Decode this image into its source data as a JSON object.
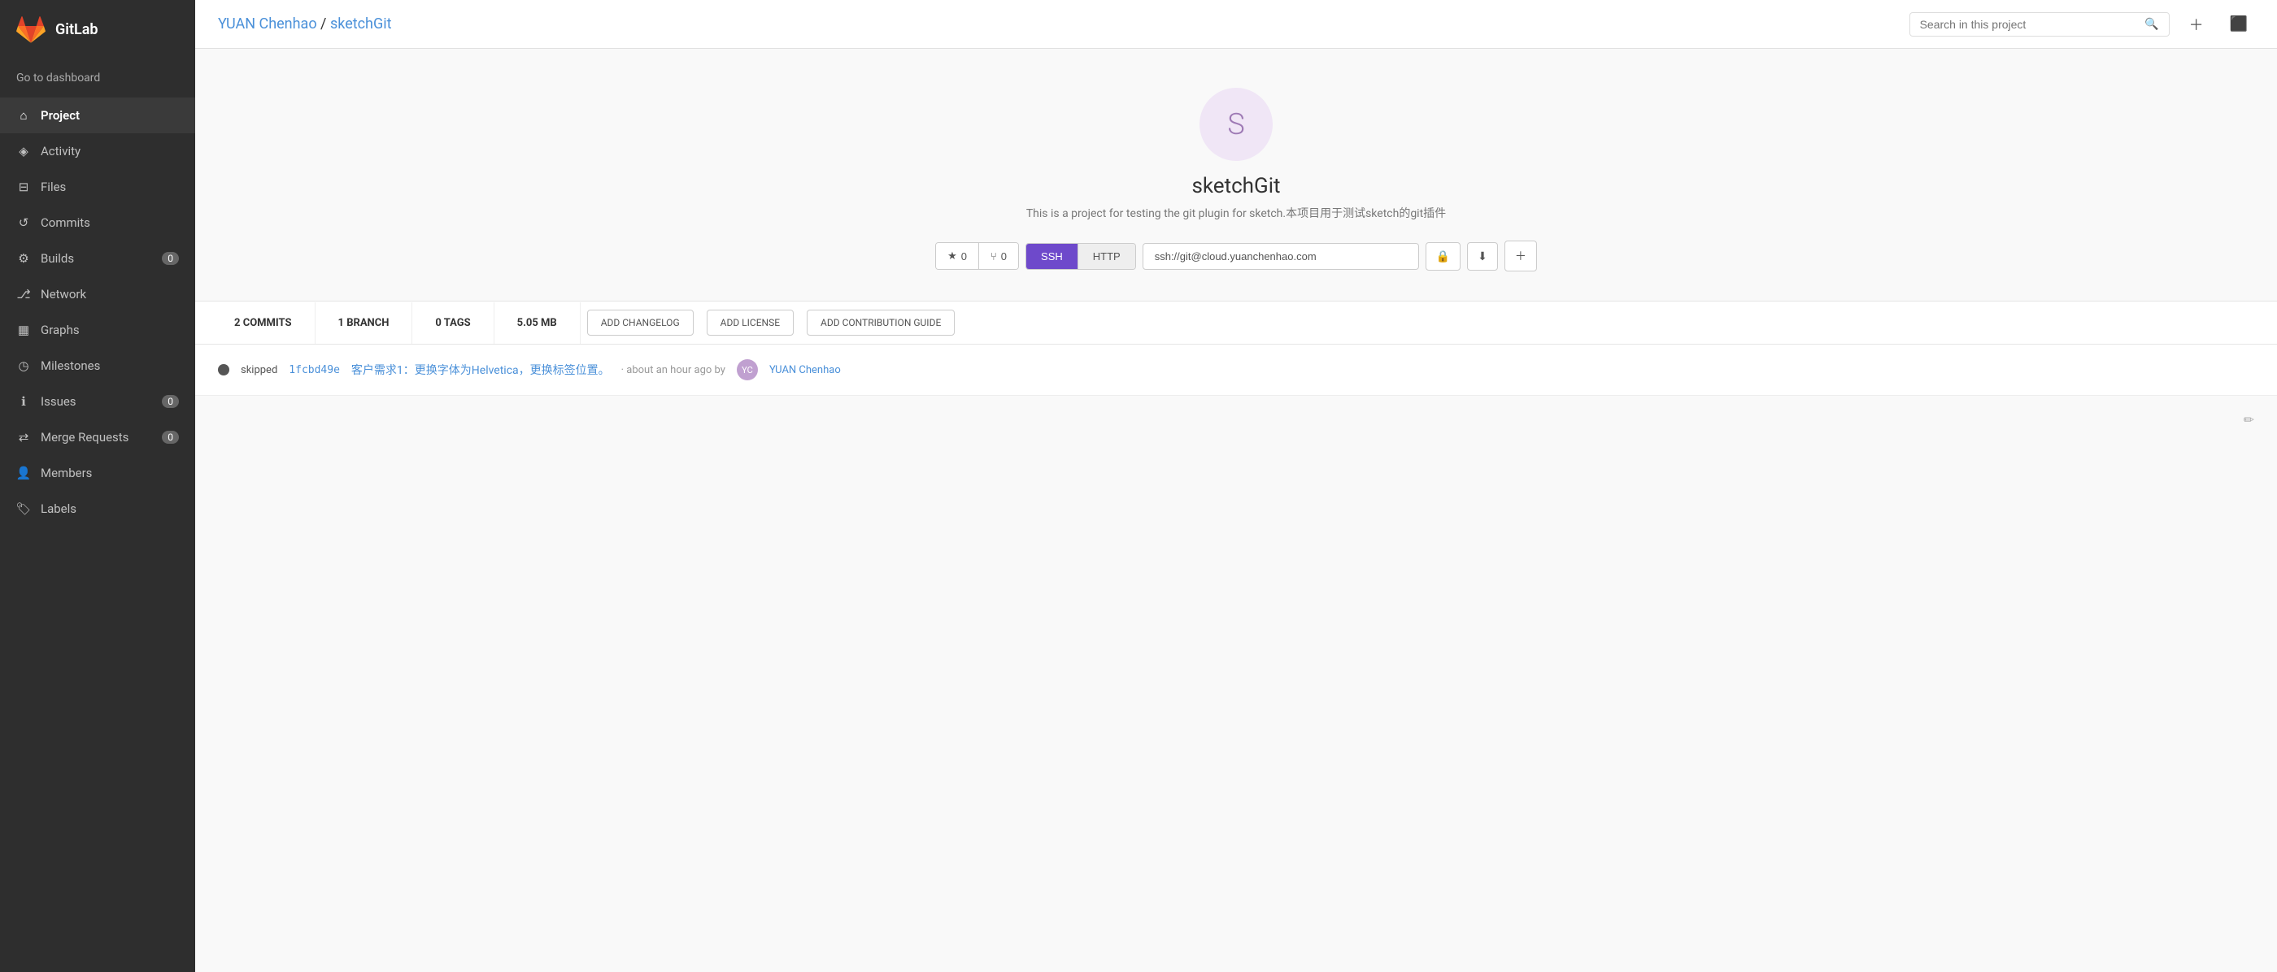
{
  "app": {
    "name": "GitLab"
  },
  "sidebar": {
    "dashboard_label": "Go to dashboard",
    "items": [
      {
        "id": "project",
        "label": "Project",
        "icon": "🏠",
        "active": true,
        "badge": null
      },
      {
        "id": "activity",
        "label": "Activity",
        "icon": "📊",
        "active": false,
        "badge": null
      },
      {
        "id": "files",
        "label": "Files",
        "icon": "📁",
        "active": false,
        "badge": null
      },
      {
        "id": "commits",
        "label": "Commits",
        "icon": "↩",
        "active": false,
        "badge": null
      },
      {
        "id": "builds",
        "label": "Builds",
        "icon": "🔧",
        "active": false,
        "badge": "0"
      },
      {
        "id": "network",
        "label": "Network",
        "icon": "🌿",
        "active": false,
        "badge": null
      },
      {
        "id": "graphs",
        "label": "Graphs",
        "icon": "📈",
        "active": false,
        "badge": null
      },
      {
        "id": "milestones",
        "label": "Milestones",
        "icon": "🕐",
        "active": false,
        "badge": null
      },
      {
        "id": "issues",
        "label": "Issues",
        "icon": "ℹ",
        "active": false,
        "badge": "0"
      },
      {
        "id": "merge-requests",
        "label": "Merge Requests",
        "icon": "🔀",
        "active": false,
        "badge": "0"
      },
      {
        "id": "members",
        "label": "Members",
        "icon": "👤",
        "active": false,
        "badge": null
      },
      {
        "id": "labels",
        "label": "Labels",
        "icon": "🏷",
        "active": false,
        "badge": null
      }
    ]
  },
  "header": {
    "breadcrumb_owner": "YUAN Chenhao",
    "breadcrumb_separator": " / ",
    "breadcrumb_project": "sketchGit",
    "search_placeholder": "Search in this project"
  },
  "project": {
    "avatar_letter": "S",
    "name": "sketchGit",
    "description": "This is a project for testing the git plugin for sketch.本项目用于测试sketch的git插件",
    "stars": "0",
    "forks": "0",
    "ssh_label": "SSH",
    "http_label": "HTTP",
    "ssh_url": "ssh://git@cloud.yuanchenhao.com"
  },
  "stats": {
    "commits": "2 COMMITS",
    "branch": "1 BRANCH",
    "tags": "0 TAGS",
    "size": "5.05 MB",
    "add_changelog": "ADD CHANGELOG",
    "add_license": "ADD LICENSE",
    "add_contribution": "ADD CONTRIBUTION GUIDE"
  },
  "commit": {
    "status": "skipped",
    "hash": "1fcbd49e",
    "message": "客户需求1：更换字体为Helvetica，更换标签位置。",
    "meta": "· about an hour ago by",
    "author_name": "YUAN Chenhao",
    "author_initials": "YC"
  }
}
